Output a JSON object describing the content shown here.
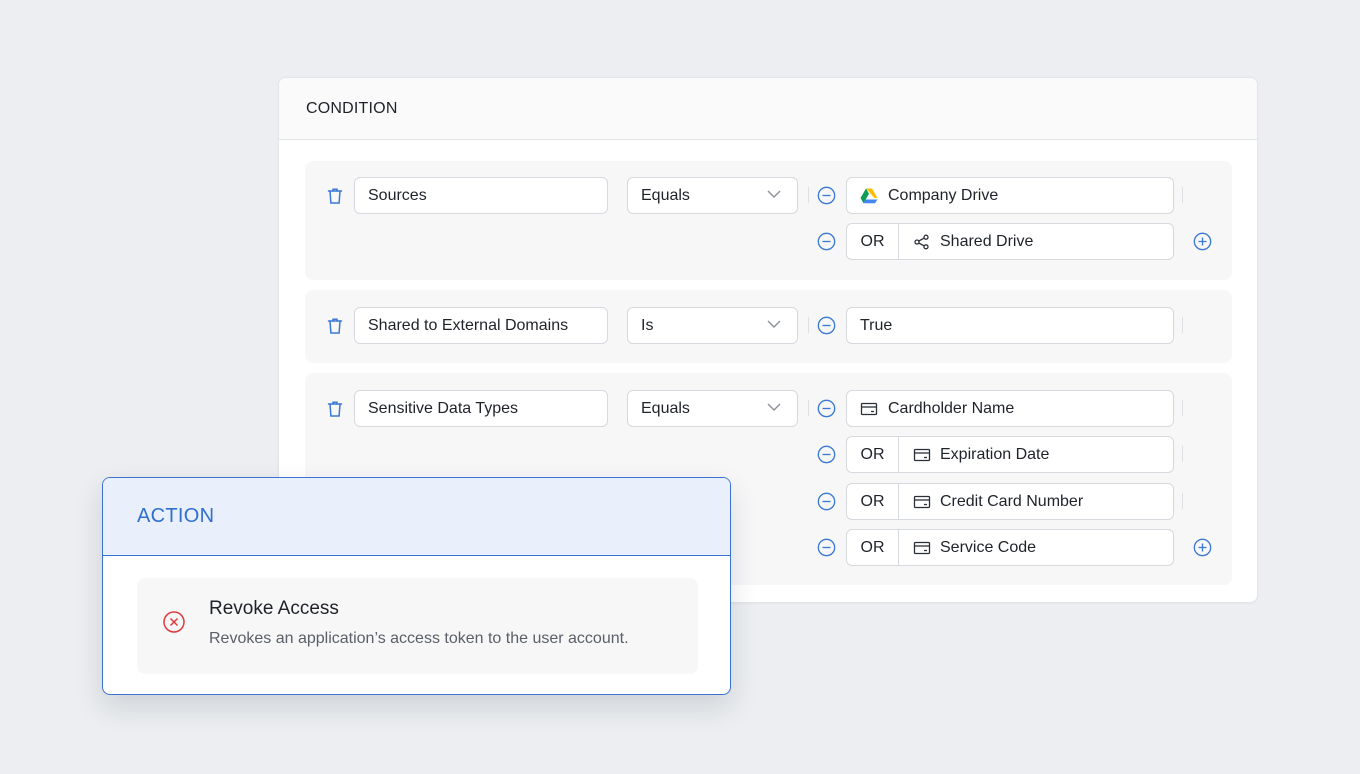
{
  "condition": {
    "title": "CONDITION",
    "rules": [
      {
        "field": "Sources",
        "operator": "Equals",
        "values": [
          {
            "or_label": "",
            "icon": "google-drive-icon",
            "label": "Company Drive"
          },
          {
            "or_label": "OR",
            "icon": "share-icon",
            "label": "Shared Drive"
          }
        ]
      },
      {
        "field": "Shared to External Domains",
        "operator": "Is",
        "values": [
          {
            "or_label": "",
            "icon": "",
            "label": "True"
          }
        ]
      },
      {
        "field": "Sensitive Data Types",
        "operator": "Equals",
        "values": [
          {
            "or_label": "",
            "icon": "credit-card-icon",
            "label": "Cardholder Name"
          },
          {
            "or_label": "OR",
            "icon": "credit-card-icon",
            "label": "Expiration Date"
          },
          {
            "or_label": "OR",
            "icon": "credit-card-icon",
            "label": "Credit Card Number"
          },
          {
            "or_label": "OR",
            "icon": "credit-card-icon",
            "label": "Service Code"
          }
        ]
      }
    ]
  },
  "action": {
    "title": "ACTION",
    "item": {
      "icon": "revoke-x-circle-icon",
      "title": "Revoke Access",
      "description": "Revokes an application’s access token to the user account."
    }
  },
  "colors": {
    "accent_blue": "#2f6fd0",
    "icon_blue": "#3a78d4",
    "danger_red": "#e0393e",
    "background": "#eceef1"
  }
}
